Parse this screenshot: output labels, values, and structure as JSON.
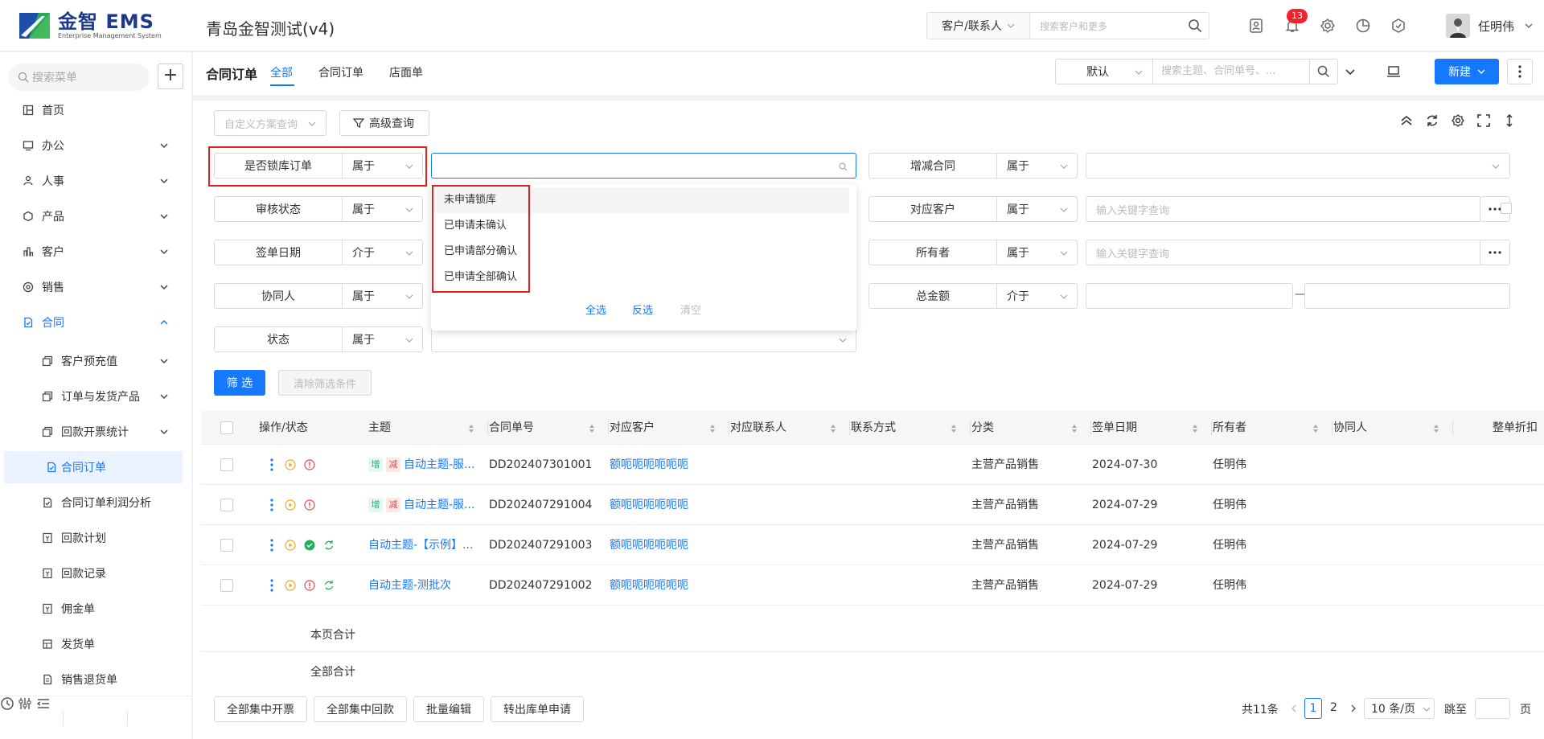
{
  "app": {
    "logo_text": "金智 EMS",
    "logo_sub": "Enterprise Management System",
    "company": "青岛金智测试(v4)",
    "search_scope": "客户/联系人",
    "search_placeholder": "搜索客户和更多",
    "notification_count": "13",
    "user_name": "任明伟",
    "brand_color": "#1677ff"
  },
  "sidebar": {
    "search_placeholder": "搜索菜单",
    "add_label": "+",
    "items": [
      {
        "label": "首页",
        "icon": "home-icon"
      },
      {
        "label": "办公",
        "icon": "office-icon"
      },
      {
        "label": "人事",
        "icon": "people-icon"
      },
      {
        "label": "产品",
        "icon": "product-icon"
      },
      {
        "label": "客户",
        "icon": "customer-icon"
      },
      {
        "label": "销售",
        "icon": "sales-icon"
      },
      {
        "label": "合同",
        "icon": "contract-icon"
      }
    ],
    "subitems": [
      {
        "label": "客户预充值"
      },
      {
        "label": "订单与发货产品"
      },
      {
        "label": "回款开票统计"
      },
      {
        "label": "合同订单"
      },
      {
        "label": "合同订单利润分析"
      },
      {
        "label": "回款计划"
      },
      {
        "label": "回款记录"
      },
      {
        "label": "佣金单"
      },
      {
        "label": "发货单"
      },
      {
        "label": "销售退货单"
      }
    ]
  },
  "header": {
    "title": "合同订单",
    "tabs": [
      "全部",
      "合同订单",
      "店面单"
    ],
    "view_select": "默认",
    "search_placeholder": "搜索主题、合同单号、...",
    "new_label": "新建"
  },
  "filters": {
    "scheme_placeholder": "自定义方案查询",
    "advanced_label": "高级查询",
    "left": [
      {
        "label": "是否锁库订单",
        "op": "属于"
      },
      {
        "label": "审核状态",
        "op": "属于"
      },
      {
        "label": "签单日期",
        "op": "介于"
      },
      {
        "label": "协同人",
        "op": "属于"
      },
      {
        "label": "状态",
        "op": "属于"
      }
    ],
    "right": [
      {
        "label": "增减合同",
        "op": "属于",
        "placeholder": ""
      },
      {
        "label": "对应客户",
        "op": "属于",
        "placeholder": "输入关键字查询"
      },
      {
        "label": "所有者",
        "op": "属于",
        "placeholder": "输入关键字查询"
      },
      {
        "label": "总金额",
        "op": "介于",
        "placeholder": ""
      }
    ],
    "range_sep": "—",
    "dropdown_options": [
      "未申请锁库",
      "已申请未确认",
      "已申请部分确认",
      "已申请全部确认"
    ],
    "dropdown_actions": {
      "select_all": "全选",
      "invert": "反选",
      "clear": "清空"
    },
    "filter_btn": "筛 选",
    "clear_btn": "清除筛选条件"
  },
  "table": {
    "headers": [
      "操作/状态",
      "主题",
      "合同单号",
      "对应客户",
      "对应联系人",
      "联系方式",
      "分类",
      "签单日期",
      "所有者",
      "协同人",
      "整单折扣"
    ],
    "rows": [
      {
        "tags": true,
        "subject": "自动主题-服...",
        "no": "DD202407301001",
        "customer": "额呃呃呃呃呃呃",
        "category": "主营产品销售",
        "date": "2024-07-30",
        "owner": "任明伟",
        "status": "warn"
      },
      {
        "tags": true,
        "subject": "自动主题-服...",
        "no": "DD202407291004",
        "customer": "额呃呃呃呃呃呃",
        "category": "主营产品销售",
        "date": "2024-07-29",
        "owner": "任明伟",
        "status": "warn"
      },
      {
        "tags": false,
        "subject": "自动主题-【示例】...",
        "no": "DD202407291003",
        "customer": "额呃呃呃呃呃呃",
        "category": "主营产品销售",
        "date": "2024-07-29",
        "owner": "任明伟",
        "status": "ok"
      },
      {
        "tags": false,
        "subject": "自动主题-测批次",
        "no": "DD202407291002",
        "customer": "额呃呃呃呃呃呃",
        "category": "主营产品销售",
        "date": "2024-07-29",
        "owner": "任明伟",
        "status": "warn-sync"
      }
    ],
    "tag_add": "增",
    "tag_sub": "减",
    "page_total_label": "本页合计",
    "all_total_label": "全部合计"
  },
  "footer": {
    "buttons": [
      "全部集中开票",
      "全部集中回款",
      "批量编辑",
      "转出库单申请"
    ],
    "total": "共11条",
    "pages": [
      "1",
      "2"
    ],
    "page_size": "10 条/页",
    "jump_label": "跳至",
    "page_unit": "页"
  }
}
